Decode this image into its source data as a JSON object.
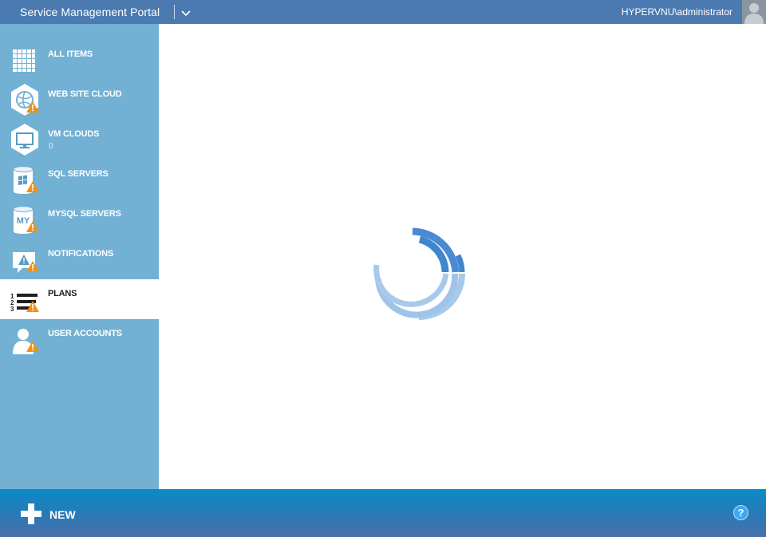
{
  "header": {
    "title": "Service Management Portal",
    "user": "HYPERVNU\\administrator"
  },
  "sidebar": {
    "items": [
      {
        "label": "ALL ITEMS",
        "icon": "grid-icon",
        "count": "",
        "warning": false,
        "active": false
      },
      {
        "label": "WEB SITE CLOUD",
        "icon": "globe-icon",
        "count": "",
        "warning": true,
        "active": false
      },
      {
        "label": "VM CLOUDS",
        "icon": "monitor-icon",
        "count": "0",
        "warning": false,
        "active": false
      },
      {
        "label": "SQL SERVERS",
        "icon": "database-windows-icon",
        "count": "",
        "warning": true,
        "active": false
      },
      {
        "label": "MYSQL SERVERS",
        "icon": "database-my-icon",
        "count": "",
        "warning": true,
        "active": false
      },
      {
        "label": "NOTIFICATIONS",
        "icon": "notification-bubble-icon",
        "count": "",
        "warning": true,
        "active": false
      },
      {
        "label": "PLANS",
        "icon": "numbered-list-icon",
        "count": "",
        "warning": true,
        "active": true
      },
      {
        "label": "USER ACCOUNTS",
        "icon": "user-icon",
        "count": "",
        "warning": true,
        "active": false
      }
    ]
  },
  "main": {
    "state": "loading"
  },
  "footer": {
    "new_label": "NEW",
    "help_label": "?"
  },
  "colors": {
    "header": "#4a7ab0",
    "sidebar": "#72b0d4",
    "warning": "#f29111",
    "spinner_dark": "#3f86cf",
    "spinner_light": "#9fc4e8"
  }
}
